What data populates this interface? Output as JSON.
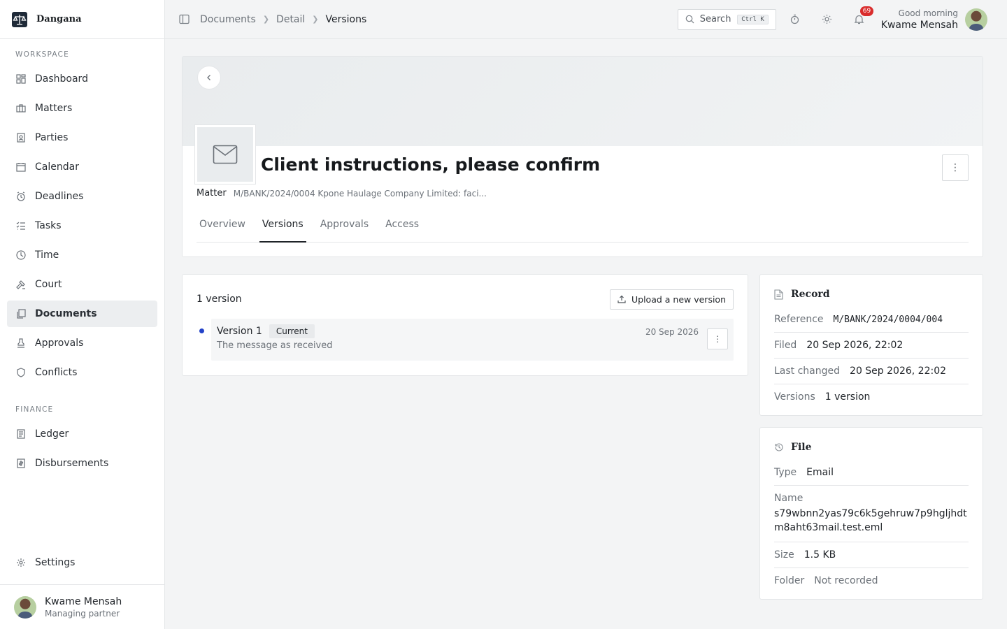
{
  "brand": {
    "name": "Dangana"
  },
  "sidebar": {
    "workspace_heading": "WORKSPACE",
    "workspace_items": [
      {
        "label": "Dashboard",
        "icon": "dashboard-icon"
      },
      {
        "label": "Matters",
        "icon": "briefcase-icon"
      },
      {
        "label": "Parties",
        "icon": "contact-card-icon"
      },
      {
        "label": "Calendar",
        "icon": "calendar-icon"
      },
      {
        "label": "Deadlines",
        "icon": "alarm-clock-icon"
      },
      {
        "label": "Tasks",
        "icon": "checklist-icon"
      },
      {
        "label": "Time",
        "icon": "clock-icon"
      },
      {
        "label": "Court",
        "icon": "gavel-icon"
      },
      {
        "label": "Documents",
        "icon": "documents-icon",
        "active": true
      },
      {
        "label": "Approvals",
        "icon": "stamp-icon"
      },
      {
        "label": "Conflicts",
        "icon": "shield-icon"
      }
    ],
    "finance_heading": "FINANCE",
    "finance_items": [
      {
        "label": "Ledger",
        "icon": "ledger-icon"
      },
      {
        "label": "Disbursements",
        "icon": "receipt-icon"
      }
    ],
    "settings_label": "Settings",
    "profile": {
      "name": "Kwame Mensah",
      "role": "Managing partner"
    }
  },
  "topbar": {
    "breadcrumbs": [
      "Documents",
      "Detail",
      "Versions"
    ],
    "search_label": "Search",
    "search_shortcut": "Ctrl K",
    "notification_count": "69",
    "greeting": "Good morning",
    "user_name": "Kwame Mensah"
  },
  "document": {
    "title": "Client instructions, please confirm",
    "matter_label": "Matter",
    "matter_value": "M/BANK/2024/0004 Kpone Haulage Company Limited: faci...",
    "tabs": [
      "Overview",
      "Versions",
      "Approvals",
      "Access"
    ],
    "active_tab": "Versions"
  },
  "versions": {
    "count_label": "1 version",
    "upload_label": "Upload a new version",
    "items": [
      {
        "name": "Version 1",
        "tag": "Current",
        "description": "The message as received",
        "date": "20 Sep 2026"
      }
    ]
  },
  "record": {
    "title": "Record",
    "reference_label": "Reference",
    "reference_value": "M/BANK/2024/0004/004",
    "filed_label": "Filed",
    "filed_value": "20 Sep 2026, 22:02",
    "changed_label": "Last changed",
    "changed_value": "20 Sep 2026, 22:02",
    "versions_label": "Versions",
    "versions_value": "1 version"
  },
  "file": {
    "title": "File",
    "type_label": "Type",
    "type_value": "Email",
    "name_label": "Name",
    "name_value": "s79wbnn2yas79c6k5gehruw7p9hgljhdtm8aht63mail.test.eml",
    "size_label": "Size",
    "size_value": "1.5 KB",
    "folder_label": "Folder",
    "folder_value": "Not recorded"
  },
  "colors": {
    "accent_dot": "#2342c8",
    "badge": "#d92c2c"
  }
}
